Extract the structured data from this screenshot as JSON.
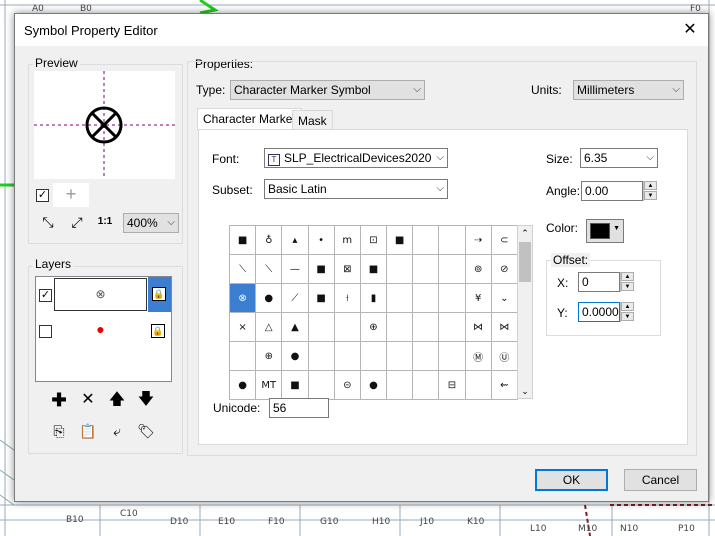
{
  "background_map": {
    "labels": [
      "A0",
      "B0",
      "F0",
      "B10",
      "C10",
      "D10",
      "E10",
      "F10",
      "G10",
      "H10",
      "J10",
      "K10",
      "L10",
      "M10",
      "N10",
      "P10"
    ]
  },
  "dialog": {
    "title": "Symbol Property Editor",
    "close_glyph": "✕"
  },
  "preview": {
    "label": "Preview",
    "zoom": "400%"
  },
  "layers": {
    "label": "Layers",
    "items": [
      {
        "glyph": "⊗",
        "checked": true
      },
      {
        "glyph": "●",
        "checked": false
      }
    ]
  },
  "properties": {
    "label": "Properties:",
    "type_label": "Type:",
    "type_value": "Character Marker Symbol",
    "units_label": "Units:",
    "units_value": "Millimeters",
    "tabs": [
      "Character Marker",
      "Mask"
    ],
    "font_label": "Font:",
    "font_value": "SLP_ElectricalDevices2020",
    "subset_label": "Subset:",
    "subset_value": "Basic Latin",
    "unicode_label": "Unicode:",
    "unicode_value": "56",
    "size_label": "Size:",
    "size_value": "6.35",
    "angle_label": "Angle:",
    "angle_value": "0.00",
    "color_label": "Color:",
    "color_value": "#000000",
    "offset_label": "Offset:",
    "x_label": "X:",
    "x_value": "0",
    "y_label": "Y:",
    "y_value": "0.0000"
  },
  "char_grid": [
    [
      "■",
      "♁",
      "▴",
      "•",
      "ⅿ",
      "⊡",
      "■",
      "",
      "",
      "⇢",
      "⊂"
    ],
    [
      "⟍",
      "⟍",
      "—",
      "■",
      "⊠",
      "■",
      "",
      "",
      "",
      "⊚",
      "⊘"
    ],
    [
      "⊗",
      "●",
      "⟋",
      "■",
      "⟊",
      "▮",
      "",
      "",
      "",
      "¥",
      "⌄"
    ],
    [
      "×",
      "△",
      "▲",
      "",
      "",
      "⊕",
      "",
      "",
      "",
      "⋈",
      "⋈"
    ],
    [
      "",
      "⊕",
      "●",
      "",
      "",
      "",
      "",
      "",
      "",
      "Ⓜ",
      "Ⓤ"
    ],
    [
      "●",
      "MT",
      "■",
      "",
      "⊝",
      "●",
      "",
      "",
      "⊟",
      "",
      "⇜"
    ]
  ],
  "buttons": {
    "ok": "OK",
    "cancel": "Cancel"
  }
}
